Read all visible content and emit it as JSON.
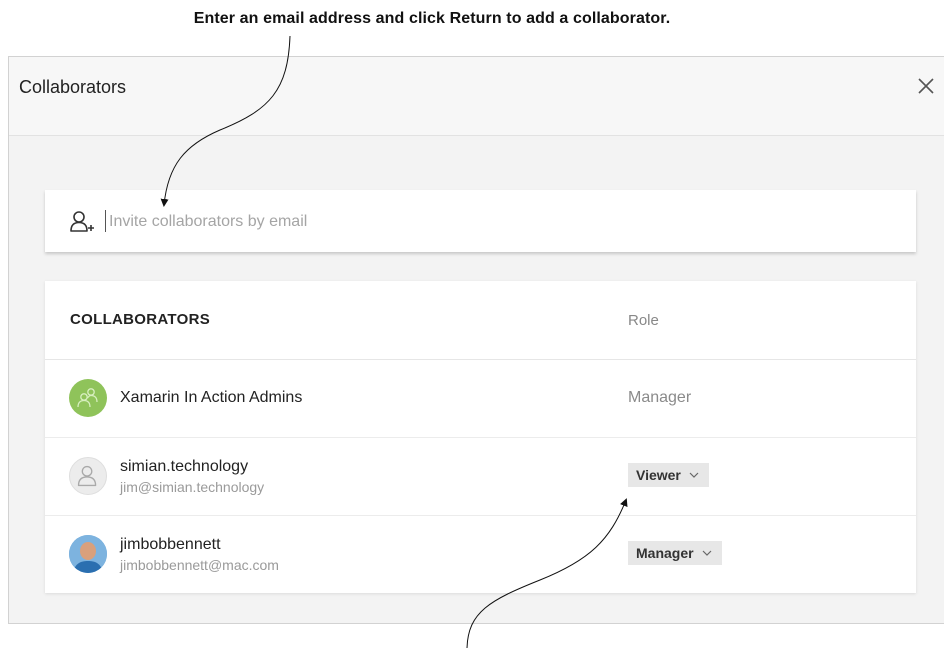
{
  "annotations": {
    "top_callout": "Enter an email address and click Return to add a collaborator."
  },
  "dialog": {
    "title": "Collaborators",
    "close_icon": "close-icon"
  },
  "invite": {
    "icon": "add-person-icon",
    "placeholder": "Invite collaborators by email",
    "value": ""
  },
  "table": {
    "headers": {
      "name": "COLLABORATORS",
      "role": "Role"
    },
    "rows": [
      {
        "name": "Xamarin In Action Admins",
        "email": "",
        "avatar": "group-avatar-icon",
        "role": "Manager",
        "role_editable": false
      },
      {
        "name": "simian.technology",
        "email": "jim@simian.technology",
        "avatar": "user-avatar-icon",
        "role": "Viewer",
        "role_editable": true
      },
      {
        "name": "jimbobbennett",
        "email": "jimbobbennett@mac.com",
        "avatar": "user-photo-avatar",
        "role": "Manager",
        "role_editable": true
      }
    ]
  },
  "colors": {
    "group_avatar": "#8fc35a",
    "dialog_bg": "#f3f3f3",
    "role_select_bg": "#e7e7e7"
  }
}
